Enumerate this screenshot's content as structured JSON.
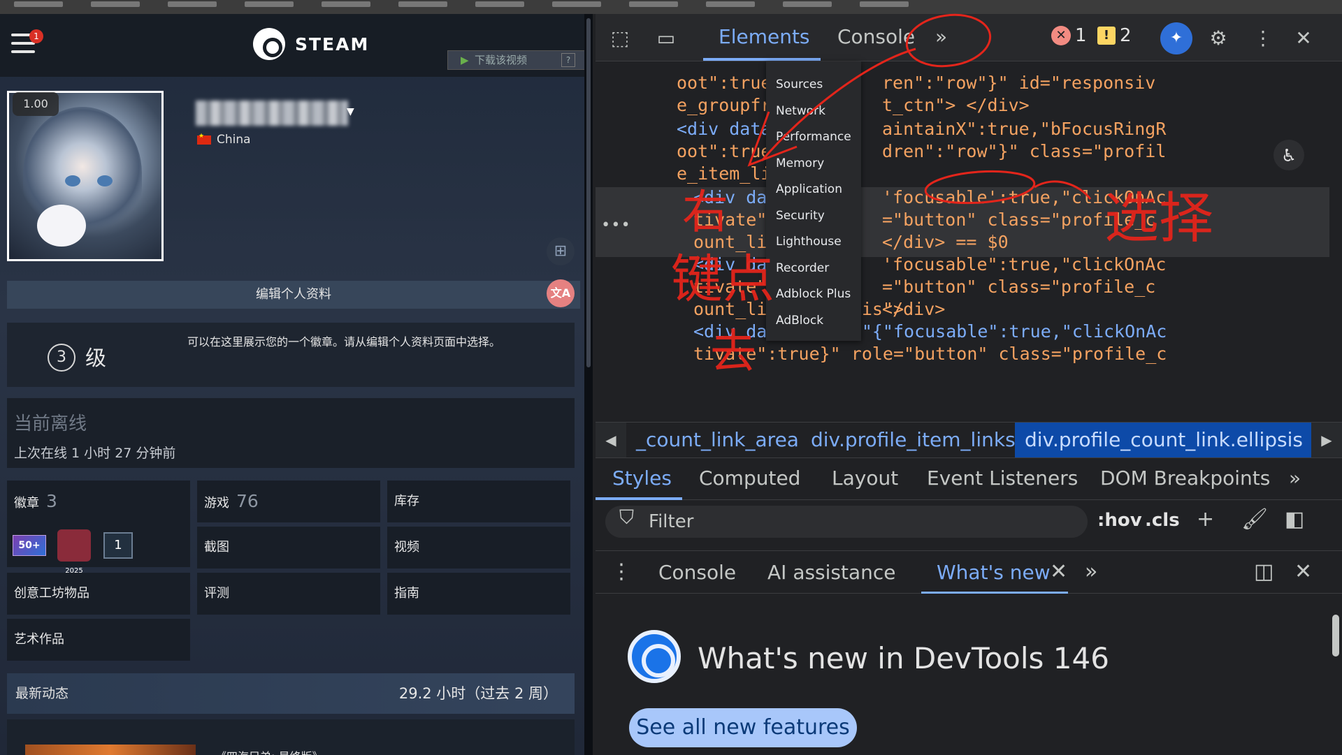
{
  "steam": {
    "notif_count": "1",
    "logo_text": "STEAM",
    "download_video": "下载该视频",
    "download_help": "?",
    "avatar_scale": "1.00",
    "country": "China",
    "edit_profile": "编辑个人资料",
    "level_num": "3",
    "level_label": "级",
    "badge_hint": "可以在这里展示您的一个徽章。请从编辑个人资料页面中选择。",
    "status_title": "当前离线",
    "last_online": "上次在线 1 小时 27 分钟前",
    "grid": {
      "badges_label": "徽章",
      "badges_count": "3",
      "games_label": "游戏",
      "games_count": "76",
      "inventory": "库存",
      "screenshots": "截图",
      "videos": "视频",
      "workshop": "创意工坊物品",
      "reviews": "评测",
      "guides": "指南",
      "artwork": "艺术作品"
    },
    "badge_50": "50+",
    "badge_2025": "2025",
    "badge_count_box": "1",
    "recent_label": "最新动态",
    "recent_hours": "29.2 小时（过去 2 周）",
    "game_name": "《四海兄弟: 最终版》"
  },
  "devtools": {
    "tabs": {
      "elements": "Elements",
      "console": "Console",
      "more": "»"
    },
    "errors": "1",
    "warnings": "2",
    "code_lines": [
      {
        "t": "oot\":true,\"",
        "t2": "ren\":\"row\"}\" id=\"responsiv"
      },
      {
        "t": "e_groupfrie",
        "t2": "t_ctn\"> </div>"
      },
      {
        "t": "<div data-p",
        "t2": "aintainX\":true,\"bFocusRingR"
      },
      {
        "t": "oot\":true,\"",
        "t2": "dren\":\"row\"}\" class=\"profil"
      },
      {
        "t": "e_item_link",
        "t2": ""
      },
      {
        "t": "<div data",
        "t2": "'focusable':true,\"clickOnAc"
      },
      {
        "t": "tivate\":t",
        "t2": "=\"button\" class=\"profile_c"
      },
      {
        "t": "ount_link",
        "t2": "</div> == $0"
      },
      {
        "t": "<div data",
        "t2": "'focusable\":true,\"clickOnAc"
      },
      {
        "t": "tivate\":t",
        "t2": "=\"button\" class=\"profile_c"
      },
      {
        "t": "ount_link ellipsis\">",
        "t2": "</div>"
      },
      {
        "t": "<div data-panel=\"{\"focusable\":true,\"clickOnAc",
        "t2": ""
      },
      {
        "t": "tivate\":true}\" role=\"button\" class=\"profile_c",
        "t2": ""
      }
    ],
    "more_menu": [
      "Sources",
      "Network",
      "Performance",
      "Memory",
      "Application",
      "Security",
      "Lighthouse",
      "Recorder",
      "Adblock Plus",
      "AdBlock"
    ],
    "breadcrumbs": [
      "_count_link_area",
      "div.profile_item_links",
      "div.profile_count_link.ellipsis"
    ],
    "styles_tabs": [
      "Styles",
      "Computed",
      "Layout",
      "Event Listeners",
      "DOM Breakpoints"
    ],
    "filter_placeholder": "Filter",
    "hov": ":hov",
    "cls": ".cls",
    "drawer_tabs": [
      "Console",
      "AI assistance",
      "What's new"
    ],
    "whats_new_title": "What's new in DevTools 146",
    "see_all": "See all new features"
  },
  "annotation": {
    "text_right_click": "右键点去",
    "text_select": "选择",
    "color": "#e3251b"
  }
}
